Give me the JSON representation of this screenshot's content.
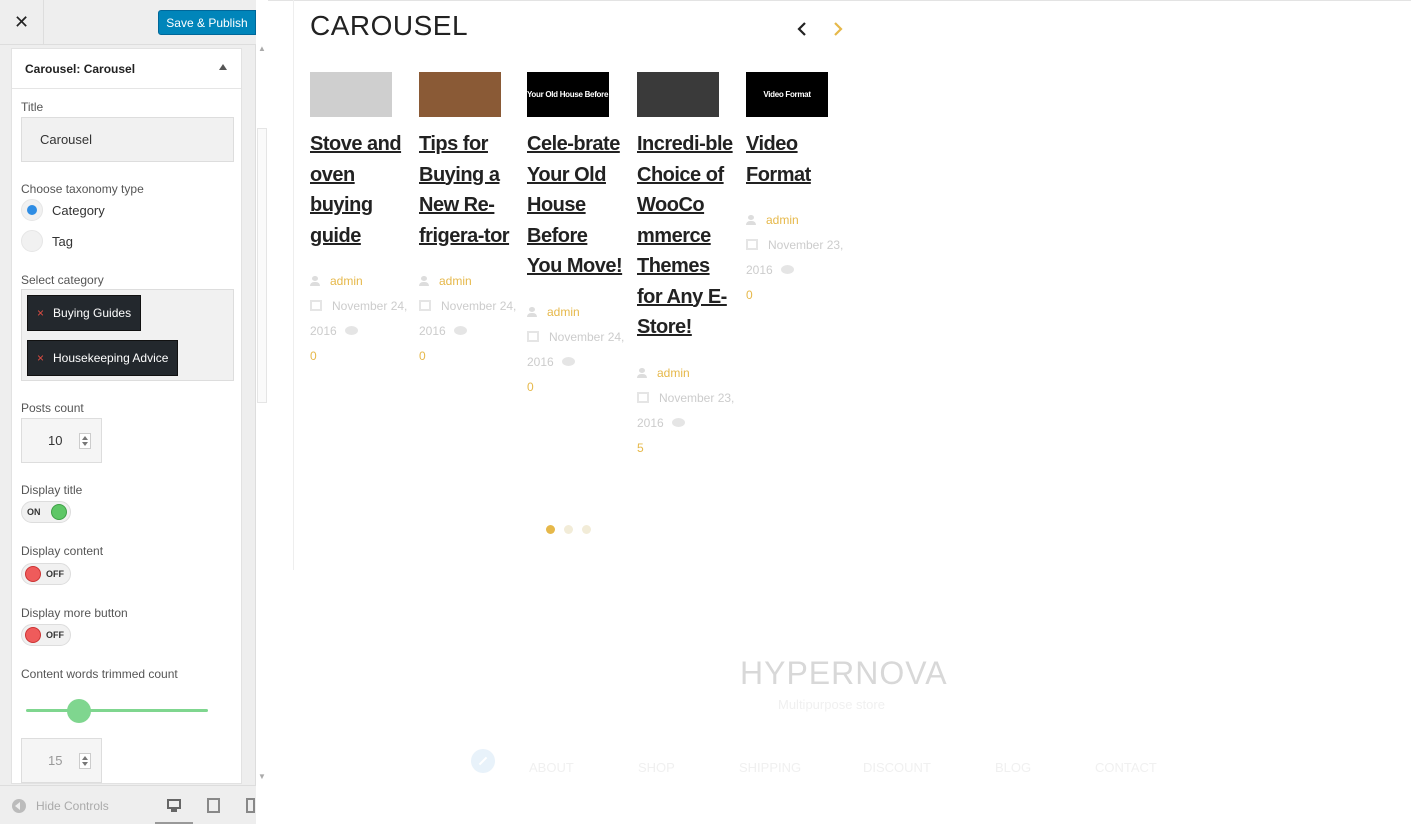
{
  "topbar": {
    "close_label": "✕",
    "publish_label": "Save & Publish"
  },
  "widget": {
    "header_prefix": "Carousel:",
    "header_name": "Carousel",
    "title_label": "Title",
    "title_value": "Carousel",
    "taxonomy_label": "Choose taxonomy type",
    "taxonomy_options": [
      "Category",
      "Tag"
    ],
    "taxonomy_selected": "Category",
    "category_label": "Select category",
    "categories": [
      "Buying Guides",
      "Housekeeping Advice"
    ],
    "category_remove": "×",
    "posts_count_label": "Posts count",
    "posts_count_value": "10",
    "display_title_label": "Display title",
    "display_title_state": "ON",
    "display_content_label": "Display content",
    "display_content_state": "OFF",
    "display_more_label": "Display more button",
    "display_more_state": "OFF",
    "trim_label": "Content words trimmed count",
    "trim_value": "15",
    "trim_slider_fraction": 0.3
  },
  "footer": {
    "hide_controls": "Hide Controls"
  },
  "preview": {
    "carousel_title": "CAROUSEL",
    "posts": [
      {
        "title": "Stove and oven buying guide",
        "author": "admin",
        "date": "November 24, 2016",
        "comments": "0",
        "thumb_text": "",
        "thumb_color": "#cfcfcf"
      },
      {
        "title": "Tips for Buying a New Re-frigera-tor",
        "author": "admin",
        "date": "November 24, 2016",
        "comments": "0",
        "thumb_text": "",
        "thumb_color": "#8a5a36"
      },
      {
        "title": "Cele-brate Your Old House Before You Move!",
        "author": "admin",
        "date": "November 24, 2016",
        "comments": "0",
        "thumb_text": "e Your Old House Before Y",
        "thumb_color": "#000000"
      },
      {
        "title": "Incredi-ble Choice of WooCo mmerce Themes for Any E-Store!",
        "author": "admin",
        "date": "November 23, 2016",
        "comments": "5",
        "thumb_text": "",
        "thumb_color": "#3a3a3a"
      },
      {
        "title": "Video Format",
        "author": "admin",
        "date": "November 23, 2016",
        "comments": "0",
        "thumb_text": "Video Format",
        "thumb_color": "#000000"
      }
    ],
    "dots_active_index": 0,
    "site_footer": {
      "brand": "HYPERNOVA",
      "tagline": "Multipurpose store",
      "nav": [
        "ABOUT",
        "SHOP",
        "SHIPPING",
        "DISCOUNT",
        "BLOG",
        "CONTACT"
      ]
    }
  },
  "colors": {
    "accent": "#0085ba",
    "star_accent": "#e6b84a",
    "toggle_on": "#5ec766",
    "toggle_off": "#ef5b5b",
    "radio": "#2f8de4"
  }
}
